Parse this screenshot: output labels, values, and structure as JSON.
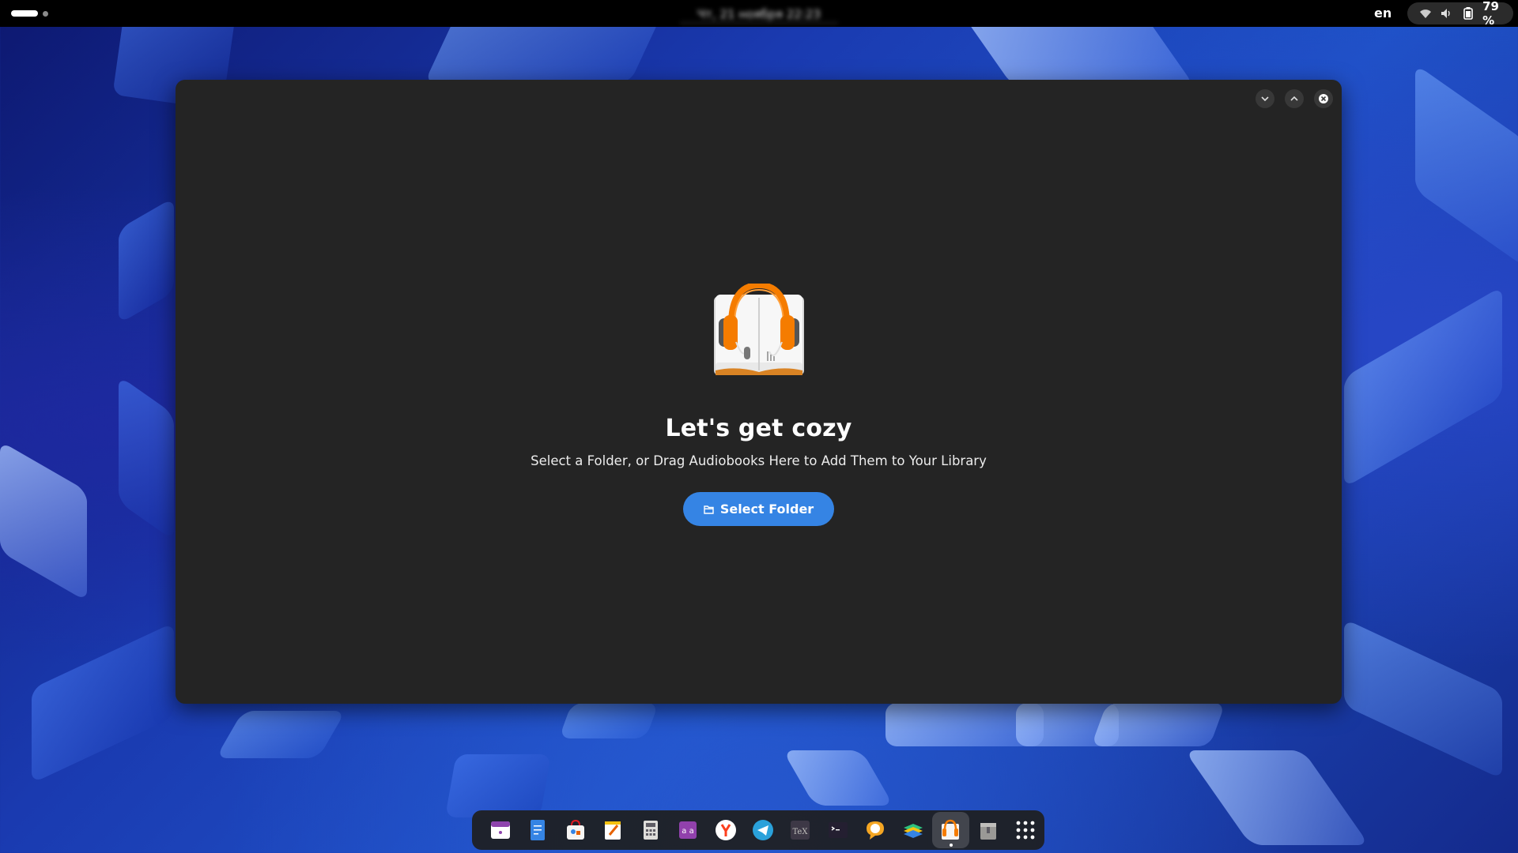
{
  "topbar": {
    "clock": "Чт, 21 ноября 22:23",
    "lang": "en",
    "battery": "79 %"
  },
  "window": {
    "title": "Let's get cozy",
    "subtitle": "Select a Folder, or Drag Audiobooks Here to Add Them to Your Library",
    "select_folder_label": "Select Folder"
  },
  "dock": {
    "items": [
      "calendar-icon",
      "text-editor-icon",
      "software-icon",
      "notes-icon",
      "calculator-icon",
      "characters-icon",
      "yandex-browser-icon",
      "telegram-icon",
      "tex-icon",
      "terminal-icon",
      "chat-icon",
      "layers-icon",
      "cozy-icon",
      "archive-icon",
      "app-grid-icon"
    ],
    "active": "cozy-icon"
  },
  "colors": {
    "accent": "#3584e4",
    "window_bg": "#242424",
    "logo_orange": "#f57c00"
  }
}
